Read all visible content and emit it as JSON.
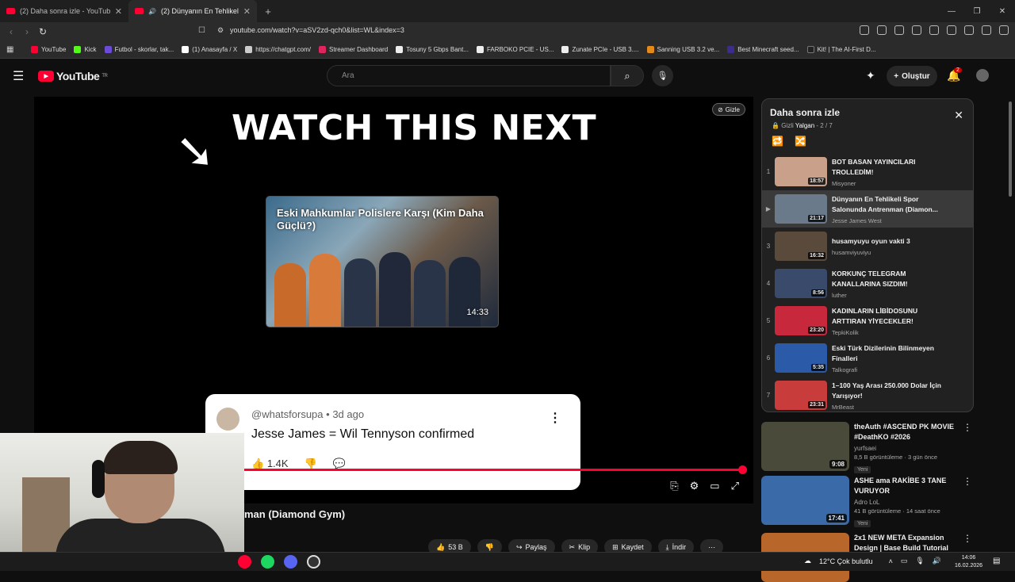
{
  "browser": {
    "tabs": [
      {
        "title": "(2) Daha sonra izle - YouTube",
        "active": false
      },
      {
        "title": "(2) Dünyanın En Tehlikeli Spor",
        "active": true
      }
    ],
    "url": "youtube.com/watch?v=aSV2zd-qch0&list=WL&index=3",
    "bookmarks": [
      {
        "label": "YouTube",
        "color": "#ff0033"
      },
      {
        "label": "Kick",
        "color": "#53fc18"
      },
      {
        "label": "Futbol - skorlar, tak...",
        "color": "#6c4bd8"
      },
      {
        "label": "(1) Anasayfa / X",
        "color": "#ffffff"
      },
      {
        "label": "https://chatgpt.com/",
        "color": "#cccccc"
      },
      {
        "label": "Streamer Dashboard",
        "color": "#e0245e"
      },
      {
        "label": "Tosuny 5 Gbps Bant...",
        "color": "#eeeeee"
      },
      {
        "label": "FARBOKO PCIE - US...",
        "color": "#eeeeee"
      },
      {
        "label": "Zunate PCIe - USB 3....",
        "color": "#eeeeee"
      },
      {
        "label": "Sanning USB 3.2 ve...",
        "color": "#e38a1b"
      },
      {
        "label": "Best Minecraft seed...",
        "color": "#3c2c8c"
      },
      {
        "label": "Kit! | The AI-First D...",
        "color": "#222222"
      }
    ]
  },
  "header": {
    "logo_text": "YouTube",
    "logo_sup": "TR",
    "search_placeholder": "Ara",
    "create_label": "Oluştur",
    "notif_count": "2"
  },
  "player": {
    "endscreen_heading": "WATCH THIS NEXT",
    "endcard_title": "Eski Mahkumlar Polislere Karşı (Kim Daha Güçlü?)",
    "endcard_duration": "14:33",
    "hide_label": "Gizle",
    "comment_user": "@whatsforsupa",
    "comment_time": "3d ago",
    "comment_text": "Jesse James = Wil Tennyson confirmed",
    "comment_likes": "1.4K",
    "progress": 1.0
  },
  "video": {
    "title_partial": "man (Diamond Gym)",
    "likes": "53 B",
    "share": "Paylaş",
    "clip": "Klip",
    "save": "Kaydet",
    "download": "İndir"
  },
  "playlist": {
    "title": "Daha sonra izle",
    "privacy": "Gizli",
    "owner": "Yalgan",
    "position": "2 / 7",
    "items": [
      {
        "idx": "1",
        "title": "BOT BASAN YAYINCILARI TROLLEDİM!",
        "channel": "Misyoner",
        "duration": "18:57",
        "color": "#c9a08a"
      },
      {
        "idx": "▶",
        "title": "Dünyanın En Tehlikeli Spor Salonunda Antrenman (Diamon...",
        "channel": "Jesse James West",
        "duration": "21:17",
        "color": "#6a7a8a"
      },
      {
        "idx": "3",
        "title": "husamyuyu oyun vakti 3",
        "channel": "husamviyuviyu",
        "duration": "16:32",
        "color": "#5a4a3c"
      },
      {
        "idx": "4",
        "title": "KORKUNÇ TELEGRAM KANALLARINA SIZDIM!",
        "channel": "luther",
        "duration": "8:56",
        "color": "#3a4a6a"
      },
      {
        "idx": "5",
        "title": "KADINLARIN LİBİDOSUNU ARTTIRAN YİYECEKLER!",
        "channel": "TepkiKolik",
        "duration": "23:20",
        "color": "#c8283c"
      },
      {
        "idx": "6",
        "title": "Eski Türk Dizilerinin Bilinmeyen Finalleri",
        "channel": "Talkografi",
        "duration": "5:35",
        "color": "#2a5aa8"
      },
      {
        "idx": "7",
        "title": "1–100 Yaş Arası 250.000 Dolar İçin Yarışıyor!",
        "channel": "MrBeast",
        "duration": "23:31",
        "color": "#c83c3c"
      }
    ]
  },
  "recommendations": [
    {
      "title": "theAuth #ASCEND PK MOVIE #DeathKO #2026",
      "channel": "yurfsaei",
      "meta": "8,5 B görüntüleme · 3 gün önce",
      "badge": "Yeni",
      "duration": "9:08",
      "color": "#4a4a3a"
    },
    {
      "title": "ASHE ama RAKİBE 3 TANE VURUYOR",
      "channel": "Adro LoL",
      "meta": "41 B görüntüleme · 14 saat önce",
      "badge": "Yeni",
      "duration": "17:41",
      "color": "#3a6aa8"
    },
    {
      "title": "2x1 NEW META Expansion Design | Base Build Tutorial",
      "channel": "",
      "meta": "",
      "badge": "",
      "duration": "",
      "color": "#b8662a"
    }
  ],
  "taskbar": {
    "weather": "12°C  Çok bulutlu",
    "time": "14:06",
    "date": "16.02.2026"
  }
}
